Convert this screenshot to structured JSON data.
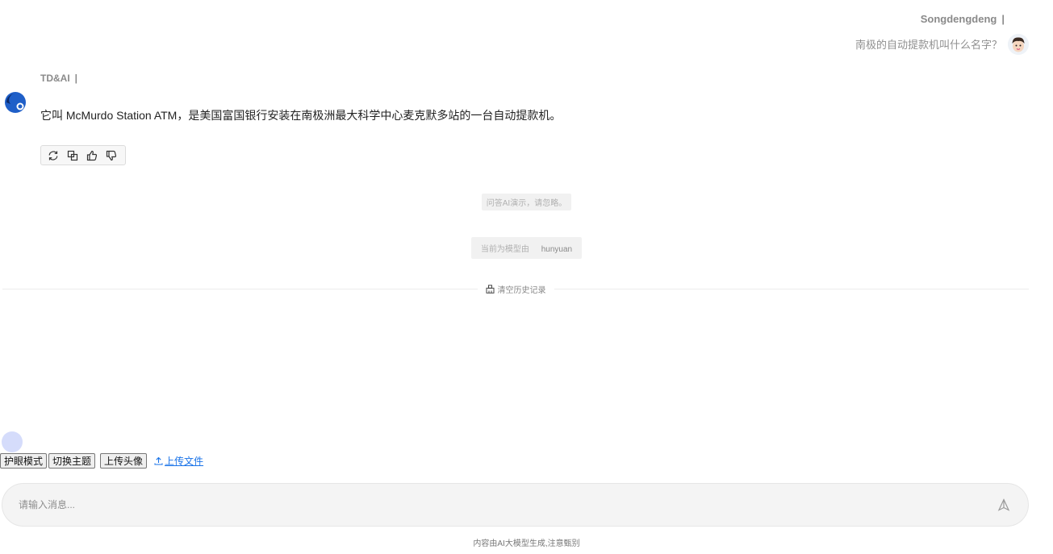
{
  "user": {
    "name": "Songdengdeng",
    "separator": "|",
    "question": "南极的自动提款机叫什么名字？"
  },
  "ai": {
    "name": "TD&AI",
    "separator": "|",
    "answer": "它叫 McMurdo Station ATM，是美国富国银行安装在南极洲最大科学中心麦克默多站的一台自动提款机。",
    "actions": [
      "refresh-icon",
      "copy-icon",
      "thumbs-up-icon",
      "thumbs-down-icon"
    ]
  },
  "notices": {
    "demo": "问答AI演示，请忽略。",
    "model_prefix": "当前为模型由",
    "model_name": "hunyuan"
  },
  "divider": {
    "clear_label": "清空历史记录"
  },
  "toolbar": {
    "eye_mode": "护眼模式",
    "switch_theme": "切换主题",
    "upload_avatar": "上传头像",
    "upload_file": "上传文件"
  },
  "input": {
    "placeholder": "请输入消息..."
  },
  "footer": {
    "note": "内容由AI大模型生成,注意甄别"
  },
  "colors": {
    "link": "#1a73e8",
    "ai_avatar": "#1f5fc8",
    "status_dot": "#d5dcfb"
  }
}
